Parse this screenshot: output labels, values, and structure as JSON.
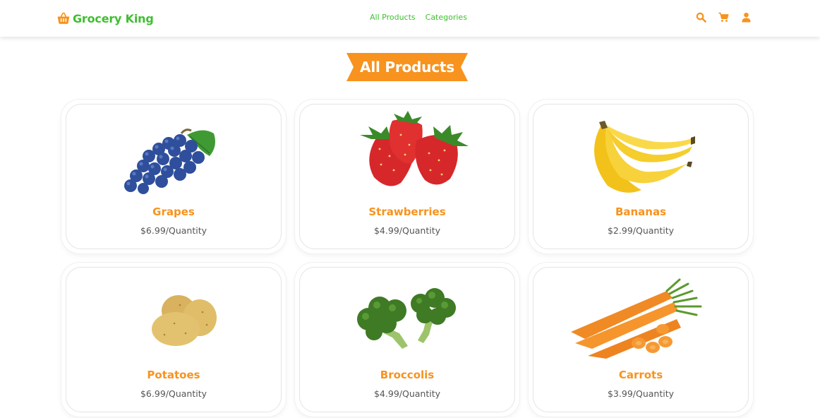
{
  "brand": {
    "name": "Grocery King",
    "icon": "basket-icon",
    "color": "#3fbf2f"
  },
  "nav": {
    "items": [
      {
        "label": "All Products"
      },
      {
        "label": "Categories"
      }
    ]
  },
  "header_icons": [
    "search-icon",
    "cart-icon",
    "user-icon"
  ],
  "colors": {
    "accent": "#f7931e",
    "brand_green": "#3fbf2f"
  },
  "page": {
    "title": "All Products"
  },
  "products": [
    {
      "name": "Grapes",
      "price": "$6.99/Quantity",
      "image": "grapes-image"
    },
    {
      "name": "Strawberries",
      "price": "$4.99/Quantity",
      "image": "strawberries-image"
    },
    {
      "name": "Bananas",
      "price": "$2.99/Quantity",
      "image": "bananas-image"
    },
    {
      "name": "Potatoes",
      "price": "$6.99/Quantity",
      "image": "potatoes-image"
    },
    {
      "name": "Broccolis",
      "price": "$4.99/Quantity",
      "image": "broccolis-image"
    },
    {
      "name": "Carrots",
      "price": "$3.99/Quantity",
      "image": "carrots-image"
    }
  ]
}
